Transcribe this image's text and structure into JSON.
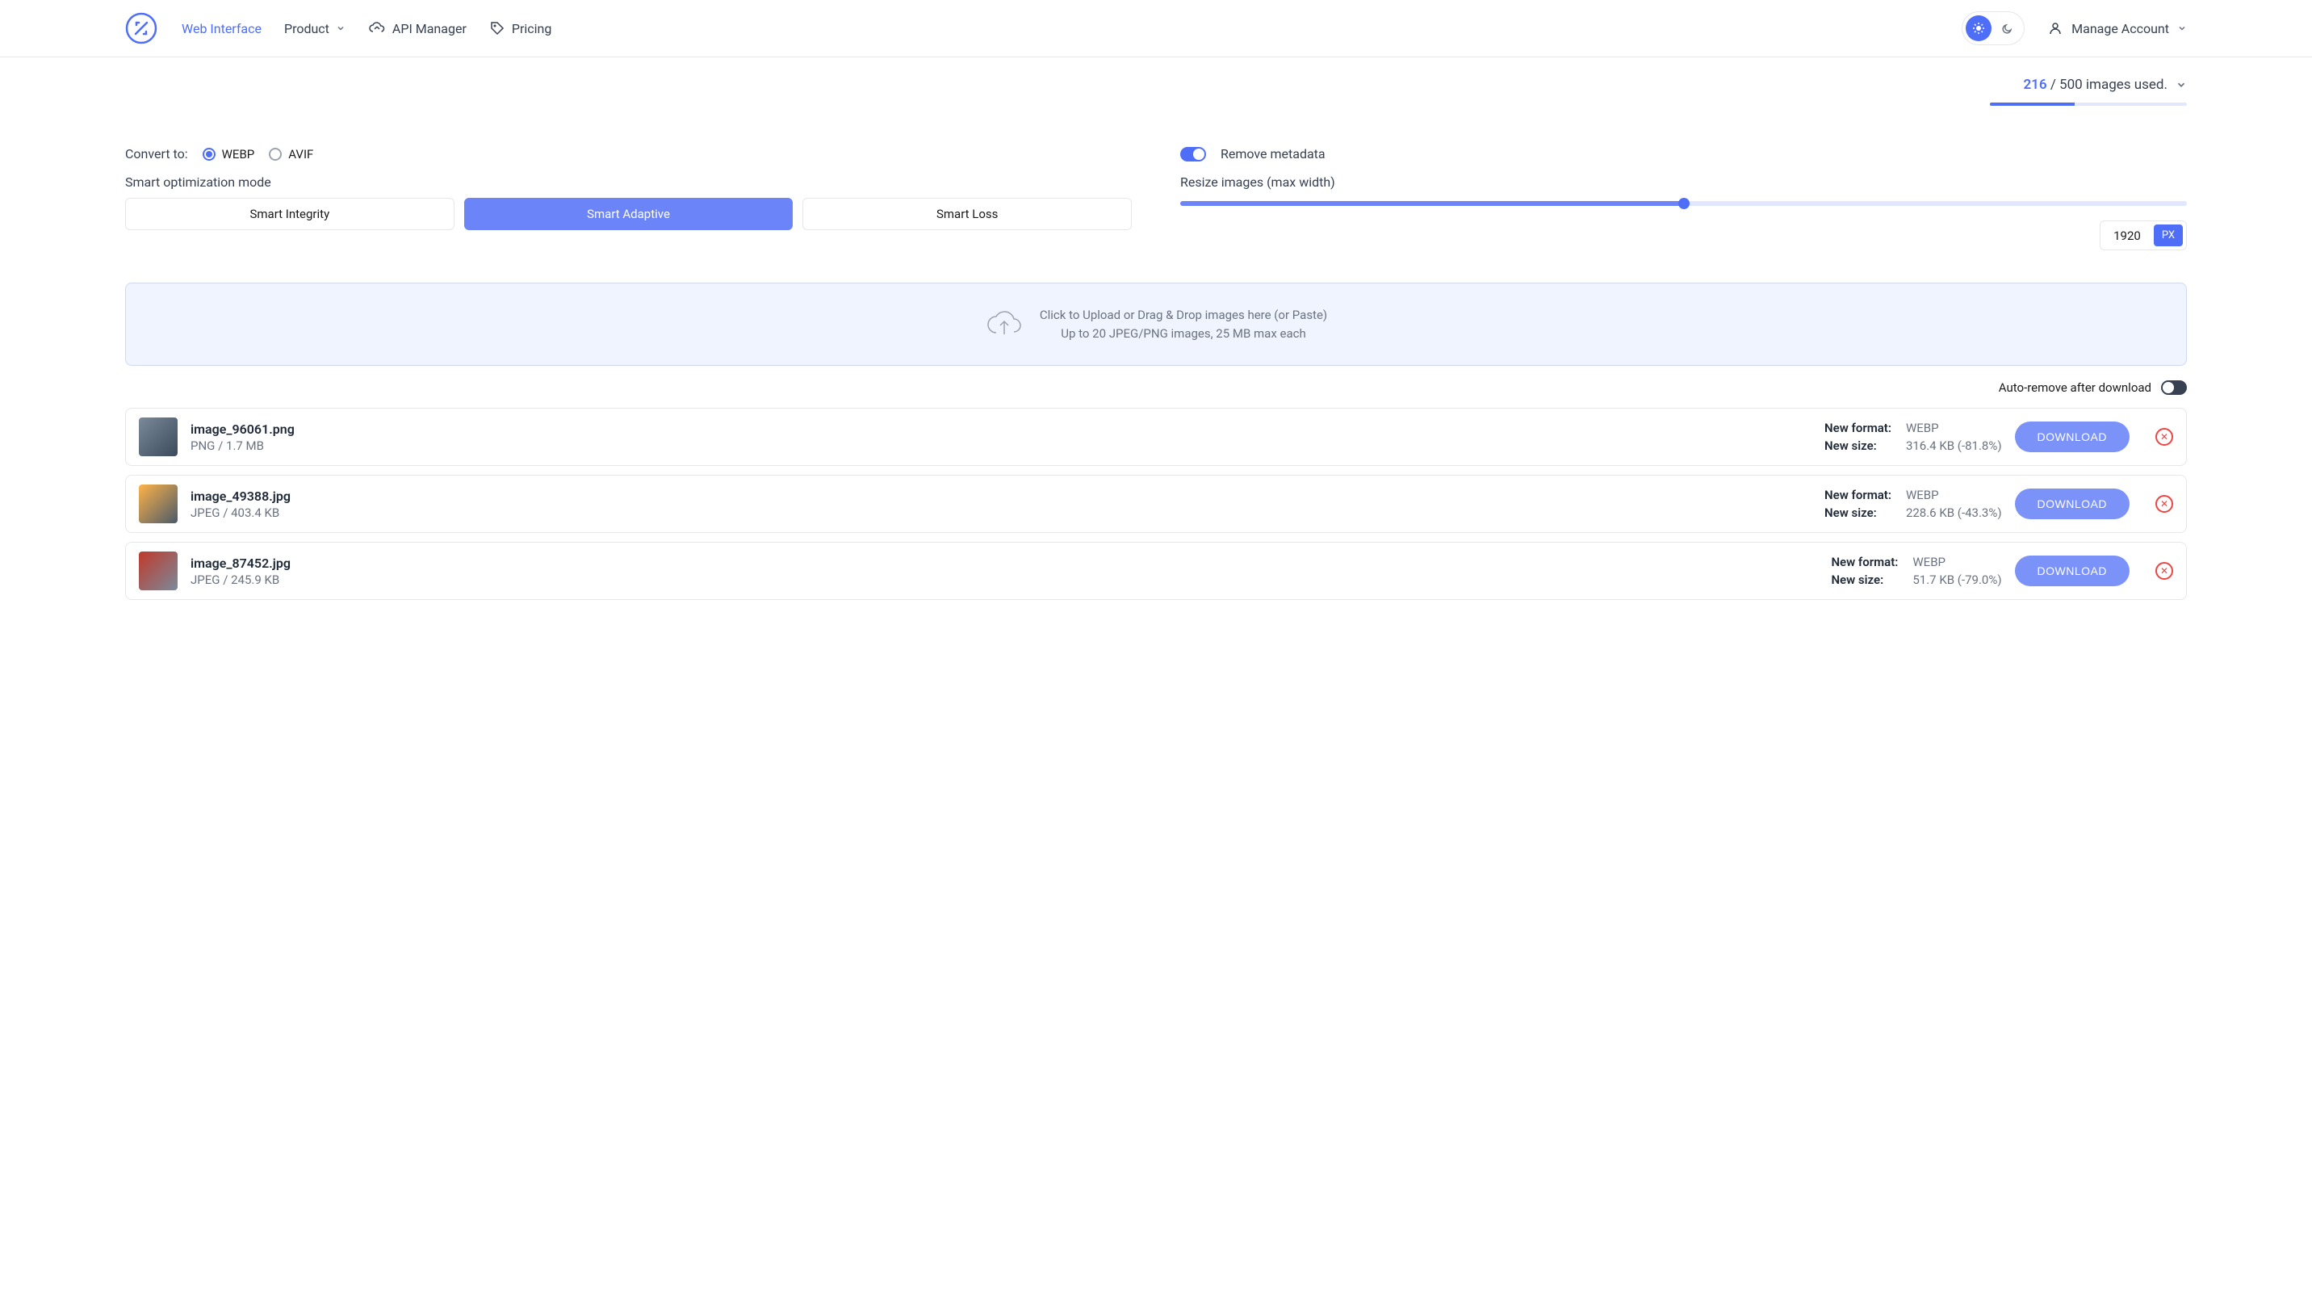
{
  "header": {
    "nav": {
      "web_interface": "Web Interface",
      "product": "Product",
      "api_manager": "API Manager",
      "pricing": "Pricing"
    },
    "account_label": "Manage Account"
  },
  "usage": {
    "used": "216",
    "total_text": "/ 500 images used.",
    "percent": 43.2
  },
  "convert": {
    "label": "Convert to:",
    "webp": "WEBP",
    "avif": "AVIF",
    "mode_label": "Smart optimization mode",
    "modes": {
      "integrity": "Smart Integrity",
      "adaptive": "Smart Adaptive",
      "loss": "Smart Loss"
    }
  },
  "metadata": {
    "label": "Remove metadata"
  },
  "resize": {
    "label": "Resize images (max width)",
    "value": "1920",
    "unit": "PX",
    "percent": 50
  },
  "dropzone": {
    "line1": "Click to Upload or Drag & Drop images here (or Paste)",
    "line2": "Up to 20 JPEG/PNG images, 25 MB max each"
  },
  "auto_remove": {
    "label": "Auto-remove after download"
  },
  "download_label": "DOWNLOAD",
  "stat_labels": {
    "format": "New format:",
    "size": "New size:"
  },
  "files": [
    {
      "name": "image_96061.png",
      "sub": "PNG / 1.7 MB",
      "format": "WEBP",
      "size": "316.4 KB (-81.8%)"
    },
    {
      "name": "image_49388.jpg",
      "sub": "JPEG / 403.4 KB",
      "format": "WEBP",
      "size": "228.6 KB (-43.3%)"
    },
    {
      "name": "image_87452.jpg",
      "sub": "JPEG / 245.9 KB",
      "format": "WEBP",
      "size": "51.7 KB (-79.0%)"
    }
  ]
}
